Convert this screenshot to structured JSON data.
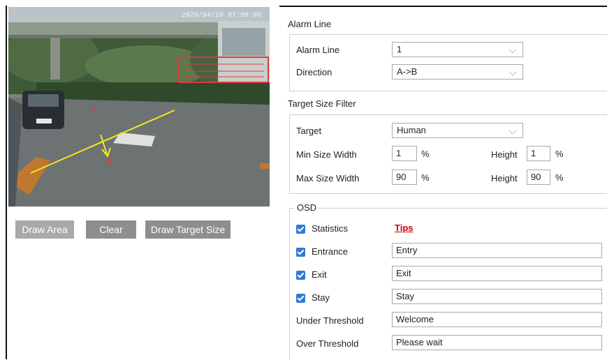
{
  "preview": {
    "timestamp": "2020/04/28 07:08:00",
    "point_a": "A",
    "point_b": "B",
    "brand_colors": {
      "line": "#f3ea1e",
      "label": "#e23a3a"
    }
  },
  "buttons": {
    "draw_area": "Draw Area",
    "clear": "Clear",
    "draw_target_size": "Draw Target Size"
  },
  "alarm_line_section": {
    "title": "Alarm Line",
    "alarm_line_label": "Alarm Line",
    "alarm_line_value": "1",
    "direction_label": "Direction",
    "direction_value": "A->B"
  },
  "target_size_section": {
    "title": "Target Size Filter",
    "target_label": "Target",
    "target_value": "Human",
    "min_width_label": "Min Size Width",
    "min_width_value": "1",
    "min_height_label": "Height",
    "min_height_value": "1",
    "max_width_label": "Max Size Width",
    "max_width_value": "90",
    "max_height_label": "Height",
    "max_height_value": "90",
    "unit": "%"
  },
  "osd_section": {
    "title": "OSD",
    "statistics_label": "Statistics",
    "tips_label": "Tips",
    "entrance_label": "Entrance",
    "entrance_value": "Entry",
    "exit_label": "Exit",
    "exit_value": "Exit",
    "stay_label": "Stay",
    "stay_value": "Stay",
    "under_threshold_label": "Under Threshold",
    "under_threshold_value": "Welcome",
    "over_threshold_label": "Over Threshold",
    "over_threshold_value": "Please wait",
    "checked_color": "#2f7ad6"
  }
}
